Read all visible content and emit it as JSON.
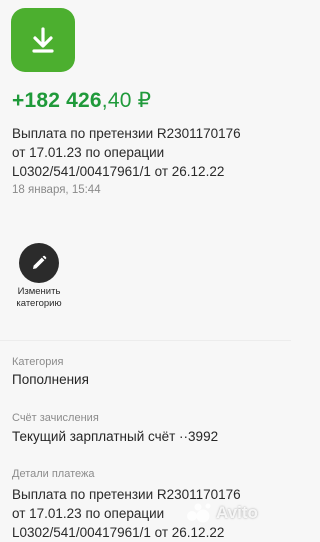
{
  "transaction": {
    "icon": "download-icon",
    "accent_color": "#4caf2f",
    "amount_main": "+182 426",
    "amount_fraction": ",40 ₽",
    "amount_color": "#1f9a3a",
    "description_lines": [
      "Выплата по претензии R2301170176",
      "от 17.01.23 по операции",
      "L0302/541/00417961/1 от 26.12.22"
    ],
    "datetime": "18 января, 15:44"
  },
  "actions": {
    "edit_category_line1": "Изменить",
    "edit_category_line2": "категорию",
    "edit_icon": "pencil-icon"
  },
  "fields": {
    "category_label": "Категория",
    "category_value": "Пополнения",
    "account_label": "Счёт зачисления",
    "account_value": "Текущий зарплатный счёт ··3992",
    "details_label": "Детали платежа",
    "details_lines": [
      "Выплата по претензии R2301170176",
      "от 17.01.23 по операции",
      "L0302/541/00417961/1 от 26.12.22"
    ]
  },
  "watermark": {
    "text": "Avito",
    "icon": "avito-logo-icon"
  }
}
